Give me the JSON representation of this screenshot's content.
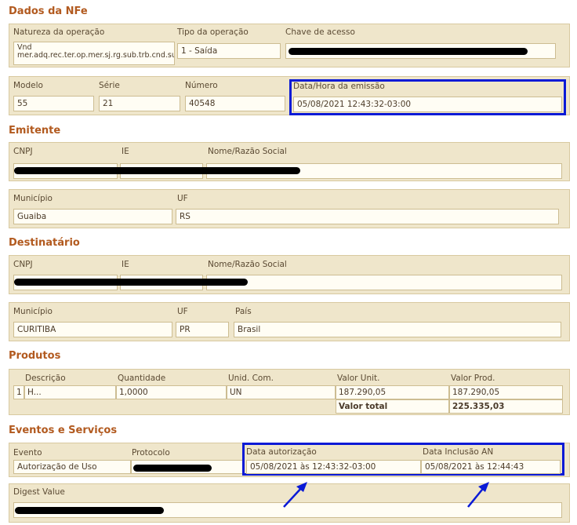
{
  "nfe": {
    "title": "Dados da NFe",
    "natureza_label": "Natureza da operação",
    "natureza_value": "Vnd mer.adq.rec.ter.op.mer.sj.rg.sub.trb.cnd.sub.t",
    "tipo_label": "Tipo da operação",
    "tipo_value": "1 - Saída",
    "chave_label": "Chave de acesso",
    "modelo_label": "Modelo",
    "modelo_value": "55",
    "serie_label": "Série",
    "serie_value": "21",
    "numero_label": "Número",
    "numero_value": "40548",
    "emissao_label": "Data/Hora da emissão",
    "emissao_value": "05/08/2021 12:43:32-03:00"
  },
  "emitente": {
    "title": "Emitente",
    "cnpj_label": "CNPJ",
    "ie_label": "IE",
    "nome_label": "Nome/Razão Social",
    "municipio_label": "Município",
    "municipio_value": "Guaiba",
    "uf_label": "UF",
    "uf_value": "RS"
  },
  "destinatario": {
    "title": "Destinatário",
    "cnpj_label": "CNPJ",
    "ie_label": "IE",
    "nome_label": "Nome/Razão Social",
    "municipio_label": "Município",
    "municipio_value": "CURITIBA",
    "uf_label": "UF",
    "uf_value": "PR",
    "pais_label": "País",
    "pais_value": "Brasil"
  },
  "produtos": {
    "title": "Produtos",
    "headers": [
      "Descrição",
      "Quantidade",
      "Unid. Com.",
      "Valor Unit.",
      "Valor Prod."
    ],
    "row": {
      "num": "1",
      "descricao": "H...",
      "quantidade": "1,0000",
      "unidade": "UN",
      "valor_unit": "187.290,05",
      "valor_prod": "187.290,05"
    },
    "total_label": "Valor total",
    "total_value": "225.335,03"
  },
  "eventos": {
    "title": "Eventos e Serviços",
    "evento_label": "Evento",
    "evento_value": "Autorização de Uso",
    "protocolo_label": "Protocolo",
    "autorizacao_label": "Data autorização",
    "autorizacao_value": "05/08/2021 às 12:43:32-03:00",
    "inclusao_label": "Data Inclusão AN",
    "inclusao_value": "05/08/2021 às 12:44:43",
    "digest_label": "Digest Value"
  },
  "colors": {
    "highlight": "#0a1ad6",
    "heading": "#b25a1f",
    "panel": "#efe6cb"
  }
}
